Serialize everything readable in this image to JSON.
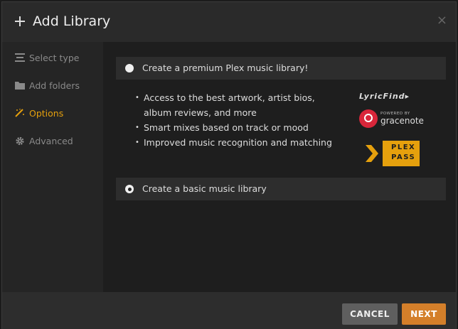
{
  "header": {
    "title": "Add Library",
    "close_glyph": "×"
  },
  "sidebar": {
    "items": [
      {
        "label": "Select type",
        "icon": "list-icon",
        "active": false
      },
      {
        "label": "Add folders",
        "icon": "folder-icon",
        "active": false
      },
      {
        "label": "Options",
        "icon": "wand-icon",
        "active": true
      },
      {
        "label": "Advanced",
        "icon": "gear-icon",
        "active": false
      }
    ]
  },
  "content": {
    "premium_option": {
      "label": "Create a premium Plex music library!",
      "selected": false
    },
    "features": [
      "Access to the best artwork, artist bios, album reviews, and more",
      "Smart mixes based on track or mood",
      "Improved music recognition and matching"
    ],
    "logos": {
      "lyricfind": "LyricFind",
      "gracenote_powered": "POWERED BY",
      "gracenote": "gracenote",
      "plexpass_line1": "PLEX",
      "plexpass_line2": "PASS"
    },
    "basic_option": {
      "label": "Create a basic music library",
      "selected": true
    }
  },
  "footer": {
    "cancel_label": "CANCEL",
    "next_label": "NEXT"
  },
  "colors": {
    "accent": "#e5a00d",
    "next_button": "#d47f2a",
    "cancel_button": "#5f5f5f",
    "gracenote_red": "#d8263a"
  }
}
